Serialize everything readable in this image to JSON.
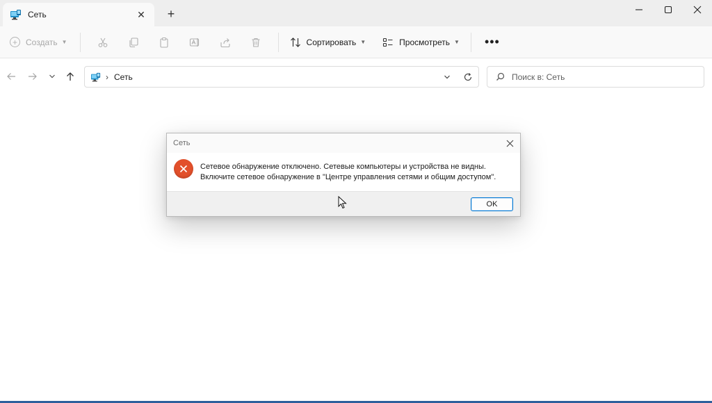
{
  "tab": {
    "title": "Сеть"
  },
  "new_tab_label": "+",
  "toolbar": {
    "create_label": "Создать",
    "sort_label": "Сортировать",
    "view_label": "Просмотреть",
    "more_label": "•••"
  },
  "address": {
    "separator": "›",
    "path": "Сеть"
  },
  "search": {
    "placeholder": "Поиск в: Сеть",
    "value": ""
  },
  "dialog": {
    "title": "Сеть",
    "message_line1": "Сетевое обнаружение отключено. Сетевые компьютеры и устройства не видны.",
    "message_line2": "Включите сетевое обнаружение в \"Центре управления сетями и общим доступом\".",
    "ok_label": "OK"
  },
  "colors": {
    "accent": "#0078d4",
    "error": "#e2502b",
    "network_icon": "#1e8fc9"
  },
  "icons": {
    "tab_icon": "network-folder-icon",
    "cut": "scissors-icon",
    "copy": "copy-icon",
    "paste": "clipboard-icon",
    "rename": "rename-icon",
    "share": "share-icon",
    "delete": "trash-icon",
    "error": "error-x-icon"
  }
}
